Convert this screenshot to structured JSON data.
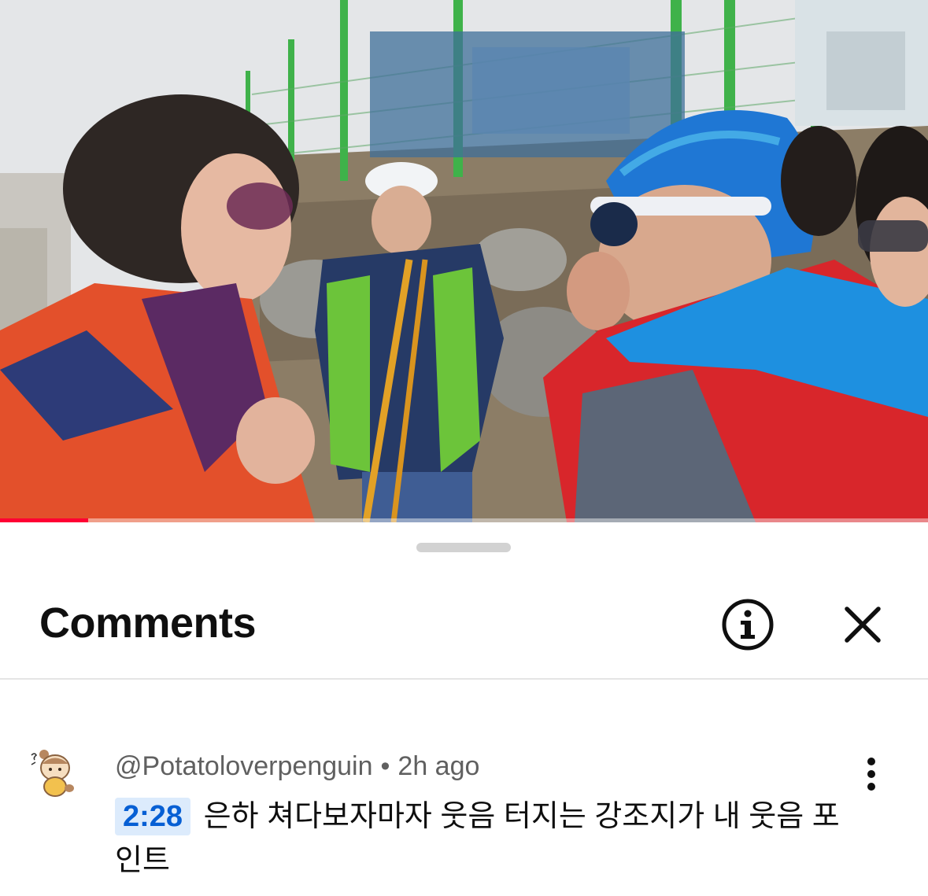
{
  "video": {
    "description_icon": "video-frame",
    "progress_fraction": 0.095,
    "progress_color": "#ff0033"
  },
  "sheet": {
    "title": "Comments",
    "info_icon": "info-icon",
    "close_icon": "close-icon"
  },
  "comments": [
    {
      "author": "@Potatoloverpenguin",
      "separator": "•",
      "time_ago": "2h ago",
      "timestamp": "2:28",
      "text": "은하 쳐다보자마자 웃음 터지는 강조지가 내 웃음 포인트",
      "more_icon": "more-vert-icon"
    }
  ],
  "colors": {
    "accent_link": "#065fd4",
    "timestamp_bg": "#dcebfc",
    "title_text": "#0f0f0f",
    "meta_text": "#606060"
  }
}
